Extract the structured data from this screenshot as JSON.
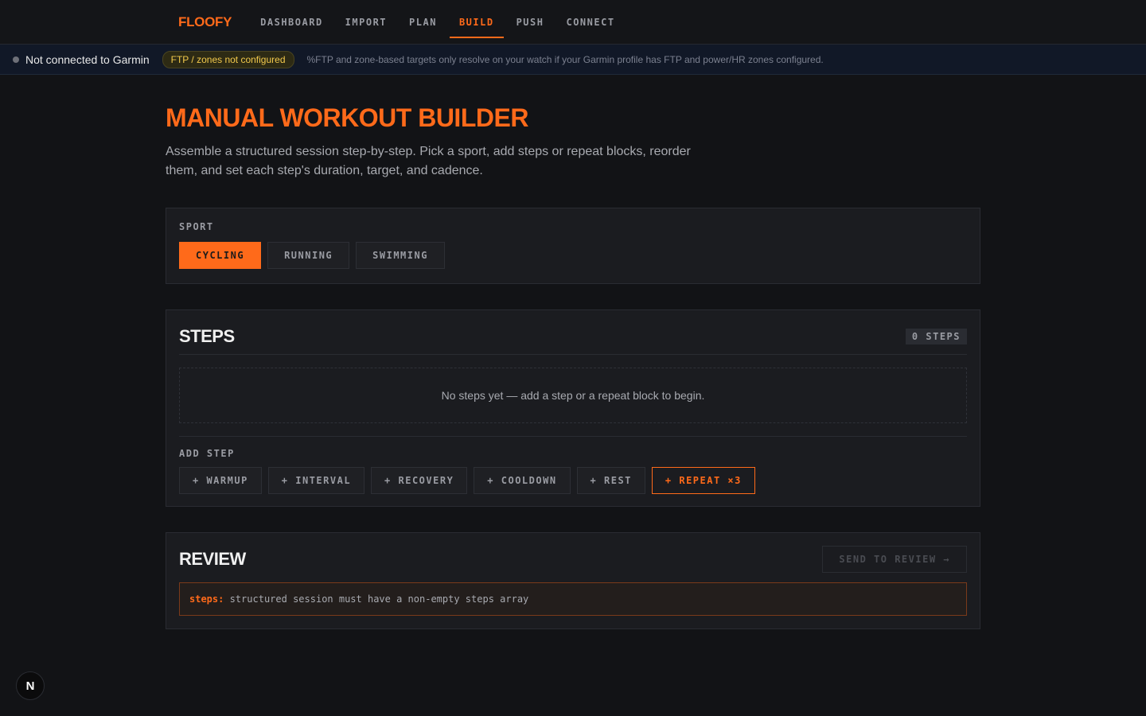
{
  "nav": {
    "brand": "FLOOFY",
    "items": [
      {
        "label": "DASHBOARD",
        "active": false
      },
      {
        "label": "IMPORT",
        "active": false
      },
      {
        "label": "PLAN",
        "active": false
      },
      {
        "label": "BUILD",
        "active": true
      },
      {
        "label": "PUSH",
        "active": false
      },
      {
        "label": "CONNECT",
        "active": false
      }
    ]
  },
  "status": {
    "connection": "Not connected to Garmin",
    "warning_badge": "FTP / zones not configured",
    "note": "%FTP and zone-based targets only resolve on your watch if your Garmin profile has FTP and power/HR zones configured."
  },
  "page": {
    "title": "MANUAL WORKOUT BUILDER",
    "description": "Assemble a structured session step-by-step. Pick a sport, add steps or repeat blocks, reorder them, and set each step's duration, target, and cadence."
  },
  "sport": {
    "label": "SPORT",
    "options": [
      {
        "label": "CYCLING",
        "selected": true
      },
      {
        "label": "RUNNING",
        "selected": false
      },
      {
        "label": "SWIMMING",
        "selected": false
      }
    ]
  },
  "steps": {
    "title": "STEPS",
    "count": "0 STEPS",
    "empty_message": "No steps yet — add a step or a repeat block to begin.",
    "add_label": "ADD STEP",
    "add_buttons": [
      {
        "label": "+ WARMUP"
      },
      {
        "label": "+ INTERVAL"
      },
      {
        "label": "+ RECOVERY"
      },
      {
        "label": "+ COOLDOWN"
      },
      {
        "label": "+ REST"
      },
      {
        "label": "+ REPEAT ×3"
      }
    ]
  },
  "review": {
    "title": "REVIEW",
    "send_button": "SEND TO REVIEW →",
    "error_key": "steps:",
    "error_message": "structured session must have a non-empty steps array"
  },
  "corner_badge": "N",
  "colors": {
    "accent": "#ff6a1a",
    "background": "#121316",
    "warning": "#f2c94c"
  }
}
